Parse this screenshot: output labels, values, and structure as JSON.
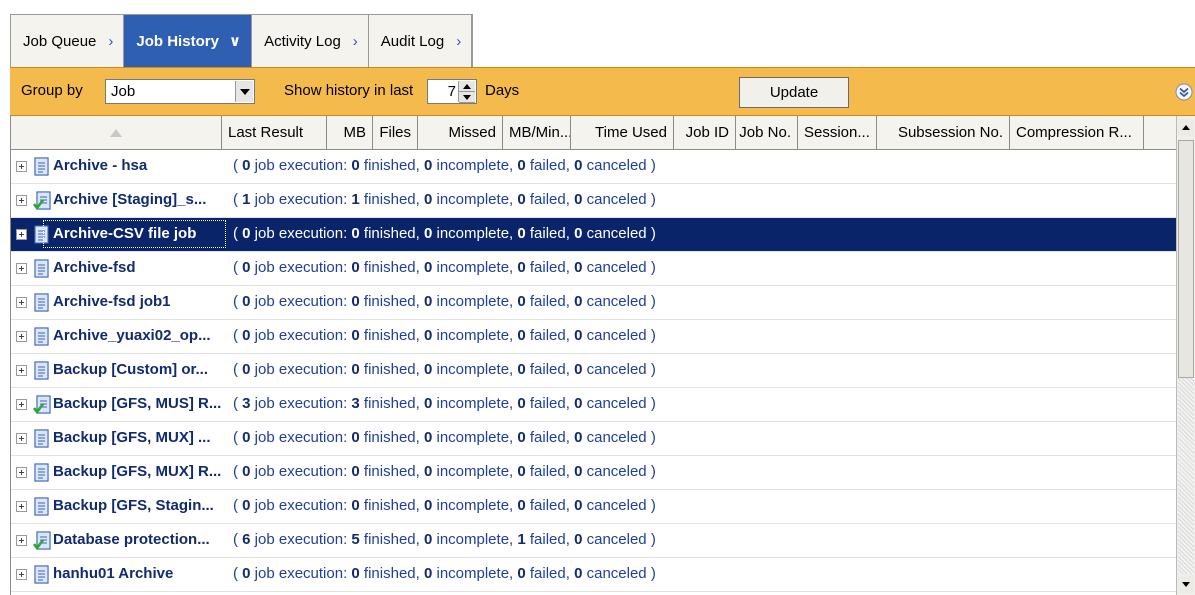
{
  "tabs": [
    {
      "label": "Job Queue",
      "active": false
    },
    {
      "label": "Job History",
      "active": true
    },
    {
      "label": "Activity Log",
      "active": false
    },
    {
      "label": "Audit Log",
      "active": false
    }
  ],
  "toolbar": {
    "group_by_label": "Group by",
    "group_by_value": "Job",
    "show_history_label": "Show history in last",
    "days_value": "7",
    "days_label": "Days",
    "update_label": "Update"
  },
  "columns": [
    "",
    "Last Result",
    "MB",
    "Files",
    "Missed",
    "MB/Min...",
    "Time Used",
    "Job ID",
    "Job No.",
    "Session...",
    "Subsession No.",
    "Compression R..."
  ],
  "rows": [
    {
      "name": "Archive - hsa",
      "icon": "job-document-icon",
      "pre": "( ",
      "n": "0",
      "a": " job execution: ",
      "fin": "0",
      "b": " finished, ",
      "inc": "0",
      "c": " incomplete, ",
      "fail": "0",
      "d": " failed, ",
      "can": "0",
      "e": " canceled )",
      "selected": false
    },
    {
      "name": "Archive [Staging]_s...",
      "icon": "job-document-check-icon",
      "pre": "( ",
      "n": "1",
      "a": " job execution: ",
      "fin": "1",
      "b": " finished, ",
      "inc": "0",
      "c": " incomplete, ",
      "fail": "0",
      "d": " failed, ",
      "can": "0",
      "e": " canceled )",
      "selected": false
    },
    {
      "name": "Archive-CSV file  job",
      "icon": "job-document-icon",
      "pre": "( ",
      "n": "0",
      "a": " job execution: ",
      "fin": "0",
      "b": " finished, ",
      "inc": "0",
      "c": " incomplete, ",
      "fail": "0",
      "d": " failed, ",
      "can": "0",
      "e": " canceled )",
      "selected": true
    },
    {
      "name": "Archive-fsd",
      "icon": "job-document-icon",
      "pre": "( ",
      "n": "0",
      "a": " job execution: ",
      "fin": "0",
      "b": " finished, ",
      "inc": "0",
      "c": " incomplete, ",
      "fail": "0",
      "d": " failed, ",
      "can": "0",
      "e": " canceled )",
      "selected": false
    },
    {
      "name": "Archive-fsd job1",
      "icon": "job-document-icon",
      "pre": "( ",
      "n": "0",
      "a": " job execution: ",
      "fin": "0",
      "b": " finished, ",
      "inc": "0",
      "c": " incomplete, ",
      "fail": "0",
      "d": " failed, ",
      "can": "0",
      "e": " canceled )",
      "selected": false
    },
    {
      "name": "Archive_yuaxi02_op...",
      "icon": "job-document-icon",
      "pre": "( ",
      "n": "0",
      "a": " job execution: ",
      "fin": "0",
      "b": " finished, ",
      "inc": "0",
      "c": " incomplete, ",
      "fail": "0",
      "d": " failed, ",
      "can": "0",
      "e": " canceled )",
      "selected": false
    },
    {
      "name": "Backup [Custom] or...",
      "icon": "job-document-icon",
      "pre": "( ",
      "n": "0",
      "a": " job execution: ",
      "fin": "0",
      "b": " finished, ",
      "inc": "0",
      "c": " incomplete, ",
      "fail": "0",
      "d": " failed, ",
      "can": "0",
      "e": " canceled )",
      "selected": false
    },
    {
      "name": "Backup [GFS, MUS] R...",
      "icon": "job-document-check-icon",
      "pre": "( ",
      "n": "3",
      "a": " job execution: ",
      "fin": "3",
      "b": " finished, ",
      "inc": "0",
      "c": " incomplete, ",
      "fail": "0",
      "d": " failed, ",
      "can": "0",
      "e": " canceled )",
      "selected": false
    },
    {
      "name": "Backup [GFS, MUX]  ...",
      "icon": "job-document-icon",
      "pre": "( ",
      "n": "0",
      "a": " job execution: ",
      "fin": "0",
      "b": " finished, ",
      "inc": "0",
      "c": " incomplete, ",
      "fail": "0",
      "d": " failed, ",
      "can": "0",
      "e": " canceled )",
      "selected": false
    },
    {
      "name": "Backup [GFS, MUX] R...",
      "icon": "job-document-icon",
      "pre": "( ",
      "n": "0",
      "a": " job execution: ",
      "fin": "0",
      "b": " finished, ",
      "inc": "0",
      "c": " incomplete, ",
      "fail": "0",
      "d": " failed, ",
      "can": "0",
      "e": " canceled )",
      "selected": false
    },
    {
      "name": "Backup [GFS, Stagin...",
      "icon": "job-document-icon",
      "pre": "( ",
      "n": "0",
      "a": " job execution: ",
      "fin": "0",
      "b": " finished, ",
      "inc": "0",
      "c": " incomplete, ",
      "fail": "0",
      "d": " failed, ",
      "can": "0",
      "e": " canceled )",
      "selected": false
    },
    {
      "name": "Database protection...",
      "icon": "job-document-check-icon",
      "pre": "( ",
      "n": "6",
      "a": " job execution: ",
      "fin": "5",
      "b": " finished, ",
      "inc": "0",
      "c": " incomplete, ",
      "fail": "1",
      "d": " failed, ",
      "can": "0",
      "e": " canceled )",
      "selected": false
    },
    {
      "name": "hanhu01 Archive",
      "icon": "job-document-icon",
      "pre": "( ",
      "n": "0",
      "a": " job execution: ",
      "fin": "0",
      "b": " finished, ",
      "inc": "0",
      "c": " incomplete, ",
      "fail": "0",
      "d": " failed, ",
      "can": "0",
      "e": " canceled )",
      "selected": false
    }
  ],
  "colors": {
    "toolbar_bg": "#f4ba4b",
    "active_tab": "#2f5fb3",
    "selection": "#0a246a",
    "job_name": "#122a6e"
  }
}
